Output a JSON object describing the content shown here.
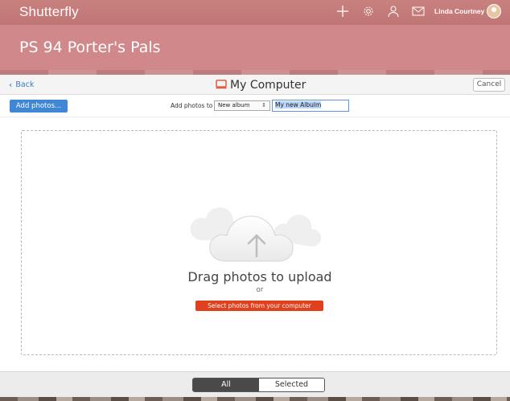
{
  "app": {
    "brand": "Shutterfly",
    "user_name": "Linda Courtney",
    "top_icons": [
      "plus-icon",
      "gear-icon",
      "person-icon",
      "mail-icon"
    ]
  },
  "group": {
    "title": "PS 94 Porter's Pals"
  },
  "nav": {
    "back_label": "Back",
    "title": "My Computer",
    "cancel_label": "Cancel"
  },
  "toolbar": {
    "add_photos_label": "Add photos...",
    "add_to_label": "Add photos to",
    "album_select_value": "New album",
    "album_name_value": "My new Albulm"
  },
  "dropzone": {
    "drag_text": "Drag photos to upload",
    "or_text": "or",
    "select_button_label": "Select photos from your computer"
  },
  "filter": {
    "all_label": "All",
    "selected_label": "Selected",
    "active": "All"
  },
  "colors": {
    "header": "#c97d7b",
    "group_bar": "#d0888a",
    "primary_button": "#3f86d4",
    "select_button": "#e0401b",
    "link": "#3b79c4"
  }
}
